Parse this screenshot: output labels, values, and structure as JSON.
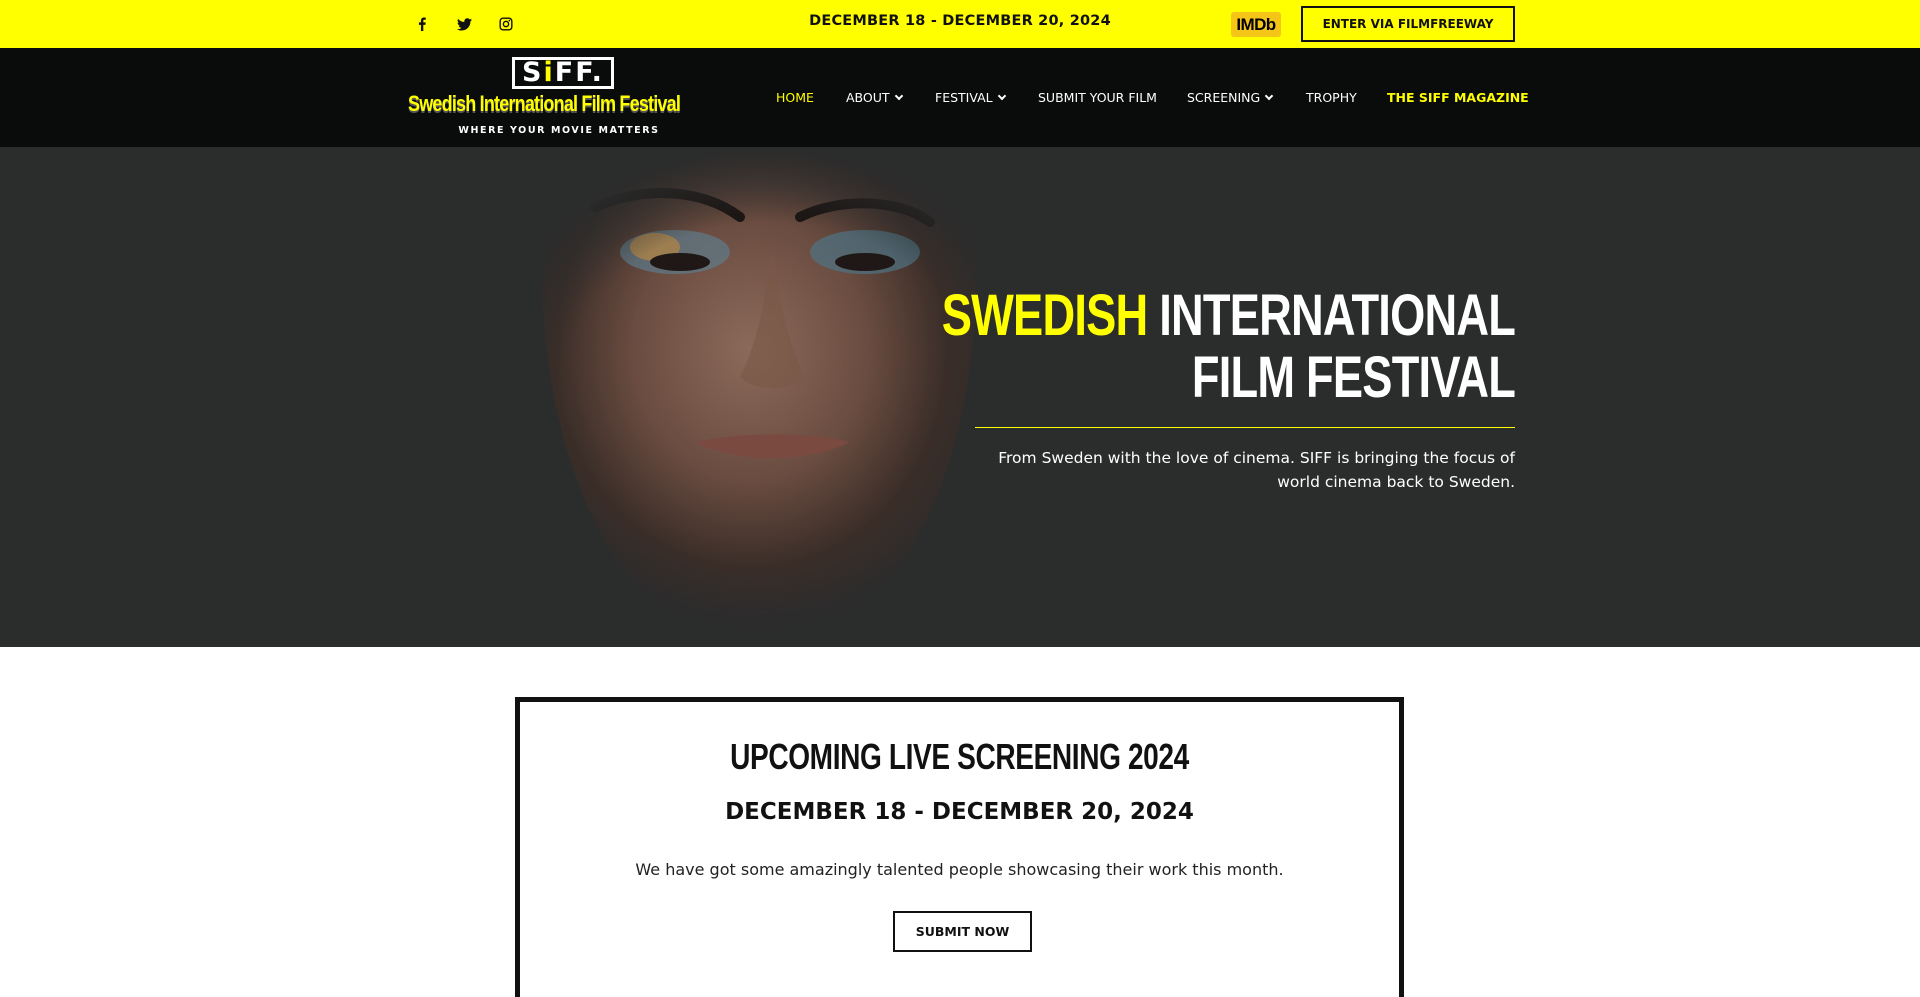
{
  "topbar": {
    "social": [
      {
        "icon": "facebook-icon"
      },
      {
        "icon": "twitter-icon"
      },
      {
        "icon": "instagram-icon"
      }
    ],
    "dates": "DECEMBER 18 - DECEMBER 20, 2024",
    "imdb_label": "IMDb",
    "enter_button": "ENTER VIA FILMFREEWAY",
    "background_color": "#ffff00"
  },
  "logo": {
    "box_text_pre": "S",
    "box_text_i": "i",
    "box_text_post": "FF.",
    "name": "Swedish International Film Festival",
    "tagline": "WHERE YOUR MOVIE MATTERS"
  },
  "nav": {
    "items": [
      {
        "label": "HOME",
        "active": true,
        "dropdown": false
      },
      {
        "label": "ABOUT",
        "active": false,
        "dropdown": true
      },
      {
        "label": "FESTIVAL",
        "active": false,
        "dropdown": true
      },
      {
        "label": "SUBMIT YOUR FILM",
        "active": false,
        "dropdown": false
      },
      {
        "label": "SCREENING",
        "active": false,
        "dropdown": true
      },
      {
        "label": "TROPHY",
        "active": false,
        "dropdown": false
      },
      {
        "label": "THE SIFF MAGAZINE",
        "active": false,
        "dropdown": false
      }
    ],
    "accent_color": "#ffff00"
  },
  "hero": {
    "title_yellow": "SWEDISH",
    "title_rest_line1": "INTERNATIONAL",
    "title_line2": "FILM FESTIVAL",
    "description": "From Sweden with the love of cinema. SIFF is bringing the focus of world cinema back to Sweden."
  },
  "upcoming": {
    "title": "UPCOMING LIVE SCREENING 2024",
    "date": "DECEMBER 18 - DECEMBER 20, 2024",
    "text": "We have got some amazingly talented people showcasing their work this month.",
    "button": "SUBMIT NOW"
  }
}
